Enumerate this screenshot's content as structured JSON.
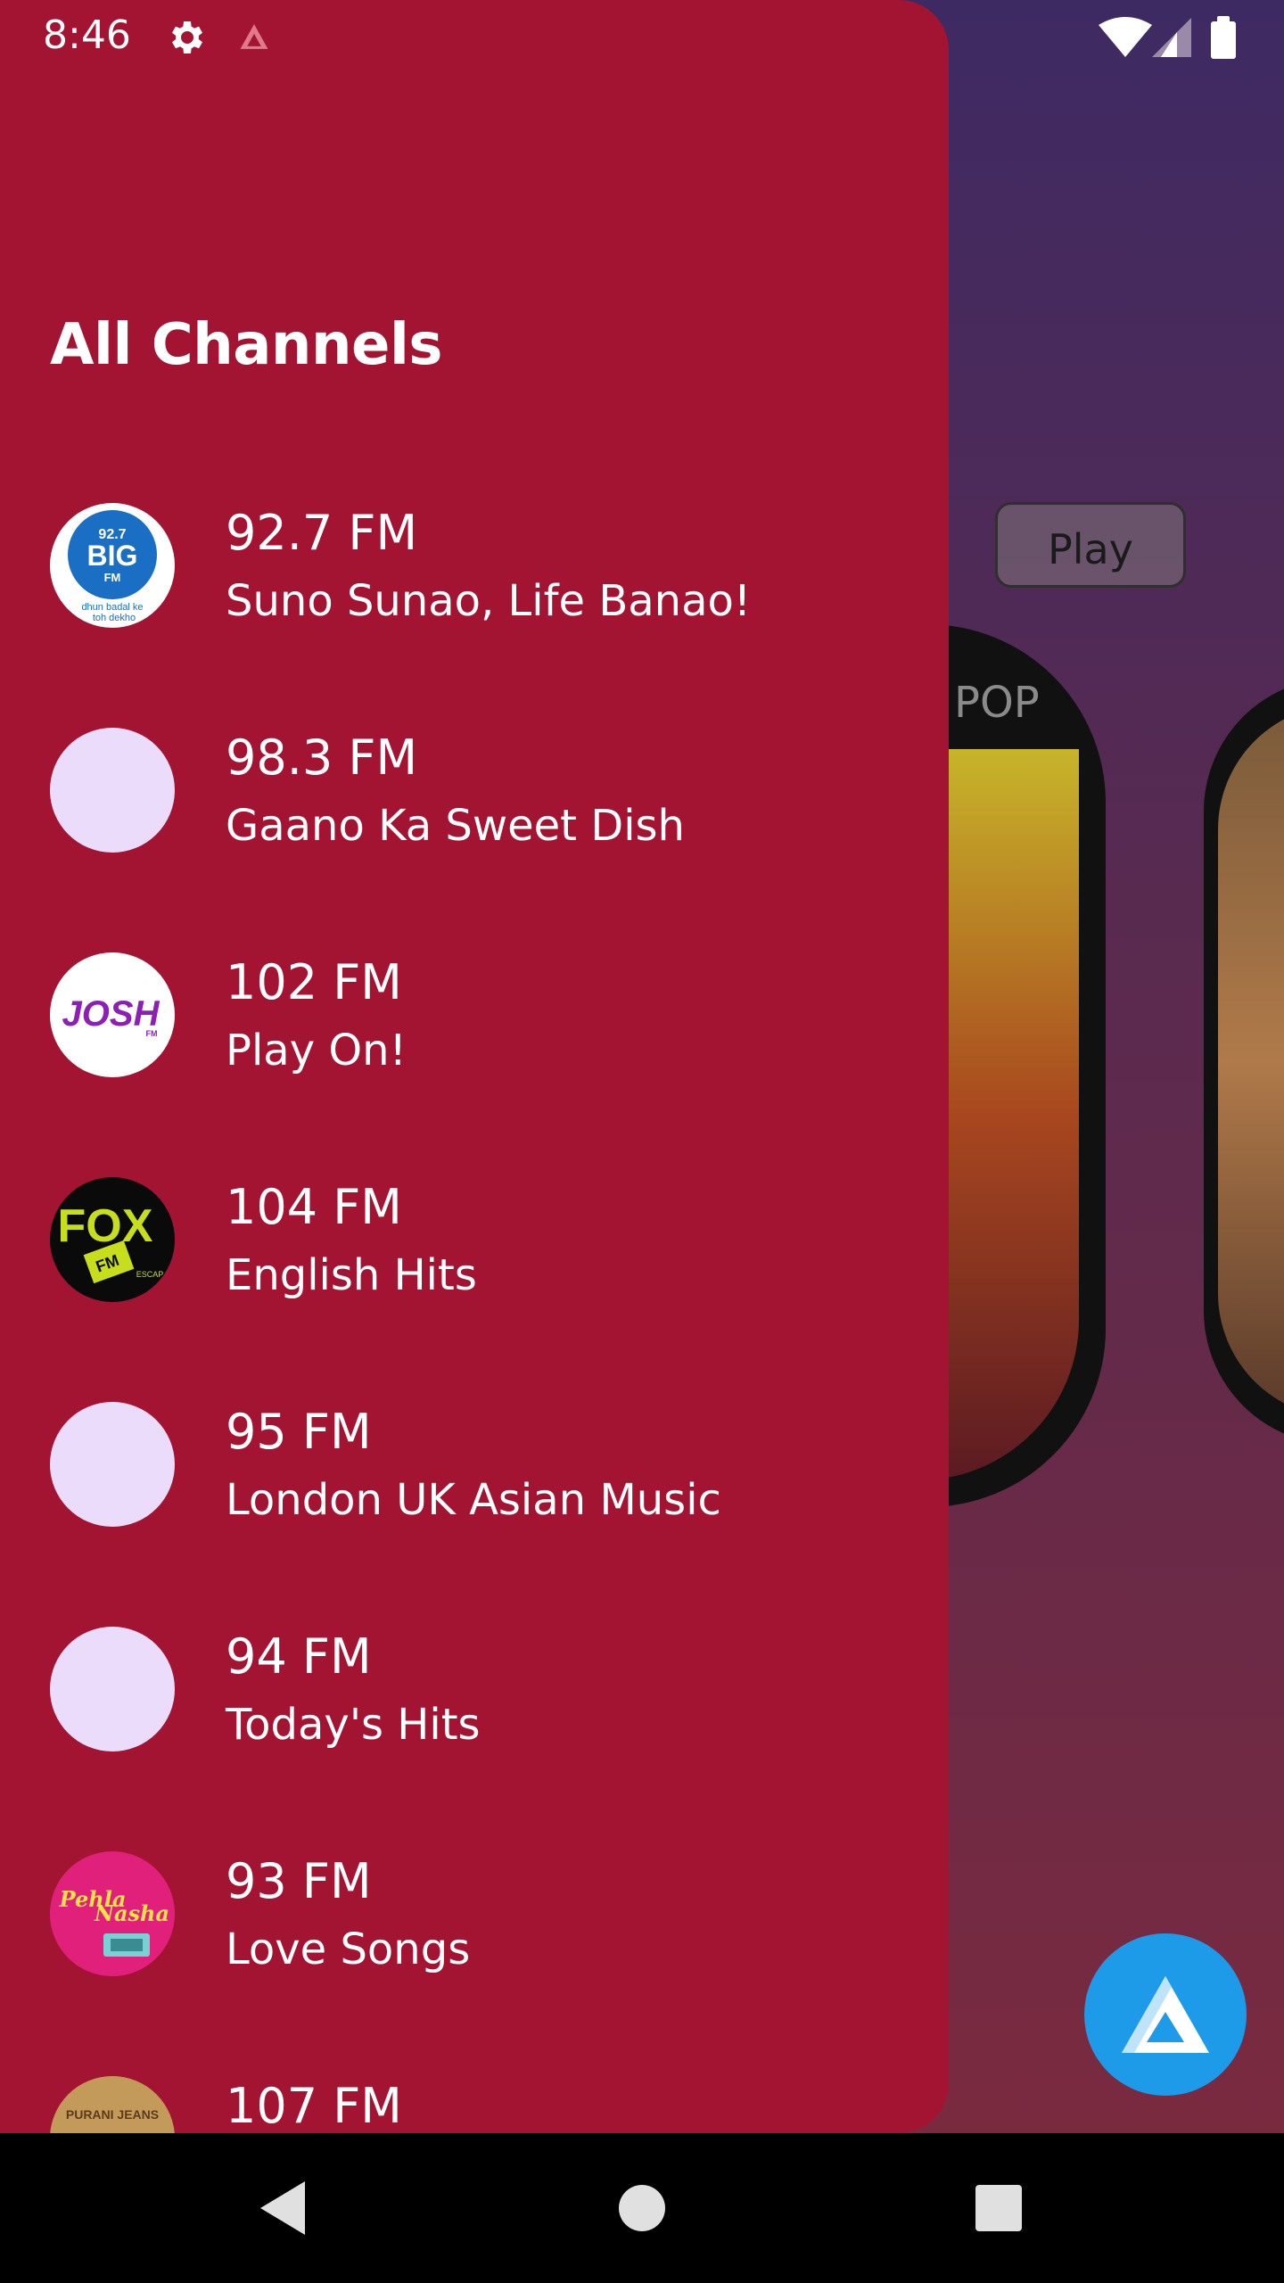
{
  "status_bar": {
    "time": "8:46",
    "gear_icon": "gear-icon",
    "app_icon": "a-logo-icon",
    "wifi_icon": "wifi-icon",
    "signal_icon": "signal-icon",
    "battery_icon": "battery-icon"
  },
  "background": {
    "play_label": "Play",
    "card_label": "POP"
  },
  "drawer": {
    "title": "All Channels",
    "channels": [
      {
        "freq": "92.7 FM",
        "tagline": "Suno Sunao, Life Banao!",
        "logo": "big-fm-logo"
      },
      {
        "freq": "98.3 FM",
        "tagline": "Gaano Ka Sweet Dish",
        "logo": "placeholder-logo"
      },
      {
        "freq": "102 FM",
        "tagline": "Play On!",
        "logo": "josh-fm-logo"
      },
      {
        "freq": "104 FM",
        "tagline": "English Hits",
        "logo": "fox-fm-logo"
      },
      {
        "freq": "95 FM",
        "tagline": "London UK Asian Music",
        "logo": "placeholder-logo"
      },
      {
        "freq": "94 FM",
        "tagline": "Today's Hits",
        "logo": "placeholder-logo"
      },
      {
        "freq": "93 FM",
        "tagline": "Love Songs",
        "logo": "pehla-nasha-logo"
      },
      {
        "freq": "107 FM",
        "tagline": "",
        "logo": "purani-jeans-logo"
      }
    ]
  },
  "fab": {
    "icon": "a-logo-icon"
  },
  "nav": {
    "back_icon": "back-icon",
    "home_icon": "home-icon",
    "recent_icon": "recent-apps-icon"
  },
  "colors": {
    "drawer_bg": "#a31432",
    "placeholder_logo": "#ebdcfb",
    "fab": "#1e9be8"
  }
}
